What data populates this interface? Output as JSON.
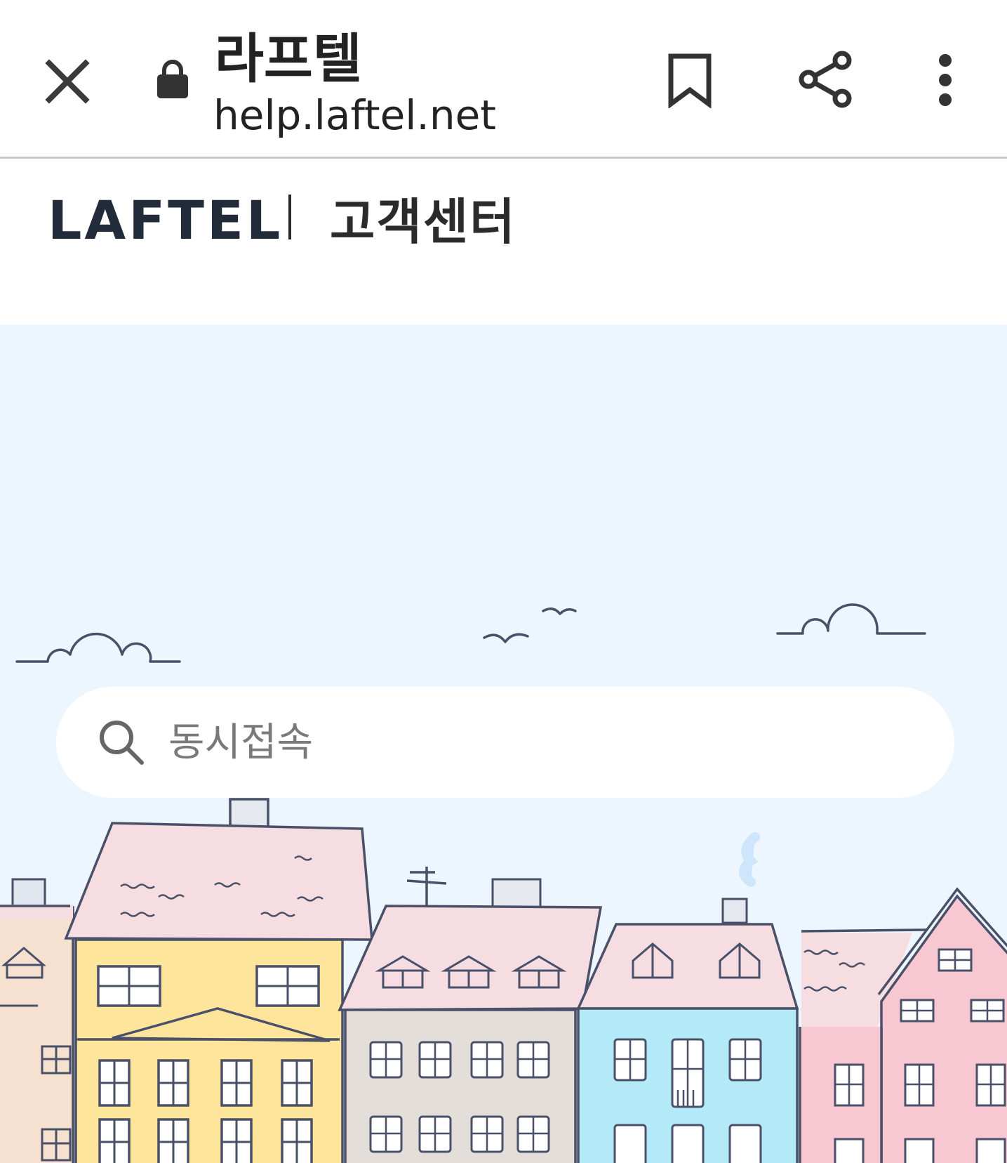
{
  "browser_toolbar": {
    "close_icon": "close-icon",
    "lock_icon": "lock-icon",
    "page_title": "라프텔",
    "url": "help.laftel.net",
    "bookmark_icon": "bookmark-icon",
    "share_icon": "share-icon",
    "more_icon": "more-vertical-icon"
  },
  "site_header": {
    "logo_text": "LAFTEL",
    "section_title": "고객센터"
  },
  "hero": {
    "search": {
      "placeholder": "동시접속",
      "icon": "search-icon"
    }
  },
  "colors": {
    "hero_background": "#edf6fe",
    "line_color": "#4a5068",
    "roof_pink": "#f5dde1",
    "house_yellow": "#fde59b",
    "house_gray": "#e4dedb",
    "house_blue": "#b4e9f8",
    "house_pink": "#f8c8d2",
    "house_peach": "#f6e0d0"
  }
}
